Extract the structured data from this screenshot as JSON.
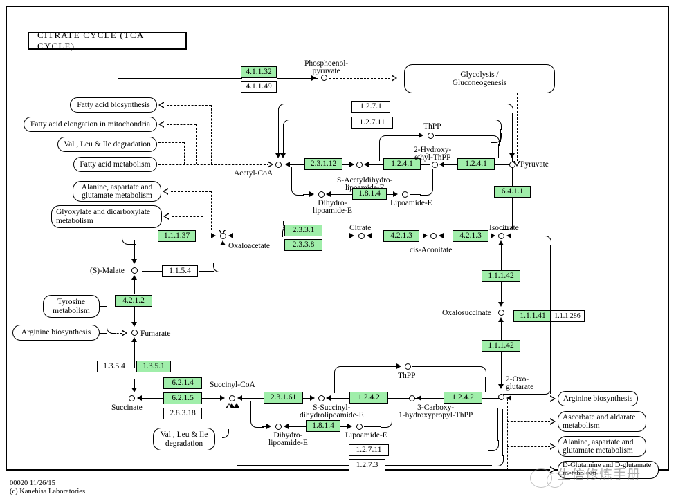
{
  "map": {
    "title": "CITRATE CYCLE (TCA CYCLE)",
    "footer": "00020 11/26/15\n(c) Kanehisa Laboratories",
    "watermark": "生信修炼手册",
    "accent_green": "#a0eeaa",
    "background": "#ffffff",
    "line_color": "#000000"
  },
  "compounds": {
    "phosphoenolpyruvate": "Phosphoenol-\npyruvate",
    "acetyl_coa": "Acetyl-CoA",
    "pyruvate": "Pyruvate",
    "thpp_top": "ThPP",
    "hydroxyethyl_thpp": "2-Hydroxy-\nethyl-ThPP",
    "s_acetyldihydrolipoamide_e": "S-Acetyldihydro-\nlipoamide-E",
    "dihydrolipoamide_e_top": "Dihydro-\nlipoamide-E",
    "lipoamide_e_top": "Lipoamide-E",
    "oxaloacetate": "Oxaloacetate",
    "citrate": "Citrate",
    "cis_aconitate": "cis-Aconitate",
    "isocitrate": "Isocitrate",
    "oxalosuccinate": "Oxalosuccinate",
    "oxoglutarate": "2-Oxo-\nglutarate",
    "s_malate": "(S)-Malate",
    "fumarate": "Fumarate",
    "succinate": "Succinate",
    "succinyl_coa": "Succinyl-CoA",
    "thpp_bottom": "ThPP",
    "s_succinyldihydrolipoamide_e": "S-Succinyl-\ndihydrolipoamide-E",
    "carboxy_hydroxypropyl_thpp": "3-Carboxy-\n1-hydroxypropyl-ThPP",
    "dihydrolipoamide_e_bottom": "Dihydro-\nlipoamide-E",
    "lipoamide_e_bottom": "Lipoamide-E"
  },
  "enzymes": {
    "ec_4_1_1_32": {
      "label": "4.1.1.32",
      "highlighted": true
    },
    "ec_4_1_1_49": {
      "label": "4.1.1.49",
      "highlighted": false
    },
    "ec_1_2_7_1": {
      "label": "1.2.7.1",
      "highlighted": false
    },
    "ec_1_2_7_11_top": {
      "label": "1.2.7.11",
      "highlighted": false
    },
    "ec_2_3_1_12": {
      "label": "2.3.1.12",
      "highlighted": true
    },
    "ec_1_2_4_1_a": {
      "label": "1.2.4.1",
      "highlighted": true
    },
    "ec_1_2_4_1_b": {
      "label": "1.2.4.1",
      "highlighted": true
    },
    "ec_1_8_1_4_top": {
      "label": "1.8.1.4",
      "highlighted": true
    },
    "ec_6_4_1_1": {
      "label": "6.4.1.1",
      "highlighted": true
    },
    "ec_1_1_1_37": {
      "label": "1.1.1.37",
      "highlighted": true
    },
    "ec_1_1_5_4": {
      "label": "1.1.5.4",
      "highlighted": false
    },
    "ec_2_3_3_1": {
      "label": "2.3.3.1",
      "highlighted": true
    },
    "ec_2_3_3_8": {
      "label": "2.3.3.8",
      "highlighted": true
    },
    "ec_4_2_1_3_a": {
      "label": "4.2.1.3",
      "highlighted": true
    },
    "ec_4_2_1_3_b": {
      "label": "4.2.1.3",
      "highlighted": true
    },
    "ec_1_1_1_42_top": {
      "label": "1.1.1.42",
      "highlighted": true
    },
    "ec_1_1_1_42_bottom": {
      "label": "1.1.1.42",
      "highlighted": true
    },
    "ec_1_1_1_41": {
      "label": "1.1.1.41",
      "highlighted": true
    },
    "ec_1_1_1_286": {
      "label": "1.1.1.286",
      "highlighted": false
    },
    "ec_4_2_1_2": {
      "label": "4.2.1.2",
      "highlighted": true
    },
    "ec_1_3_5_4": {
      "label": "1.3.5.4",
      "highlighted": false
    },
    "ec_1_3_5_1": {
      "label": "1.3.5.1",
      "highlighted": true
    },
    "ec_6_2_1_4": {
      "label": "6.2.1.4",
      "highlighted": true
    },
    "ec_6_2_1_5": {
      "label": "6.2.1.5",
      "highlighted": true
    },
    "ec_2_8_3_18": {
      "label": "2.8.3.18",
      "highlighted": false
    },
    "ec_2_3_1_61": {
      "label": "2.3.1.61",
      "highlighted": true
    },
    "ec_1_2_4_2_a": {
      "label": "1.2.4.2",
      "highlighted": true
    },
    "ec_1_2_4_2_b": {
      "label": "1.2.4.2",
      "highlighted": true
    },
    "ec_1_8_1_4_bottom": {
      "label": "1.8.1.4",
      "highlighted": true
    },
    "ec_1_2_7_11_bottom": {
      "label": "1.2.7.11",
      "highlighted": false
    },
    "ec_1_2_7_3": {
      "label": "1.2.7.3",
      "highlighted": false
    }
  },
  "pathways": {
    "glycolysis": "Glycolysis /\nGluconeogenesis",
    "fatty_acid_biosynthesis": "Fatty acid biosynthesis",
    "fatty_acid_elongation": "Fatty acid elongation in mitochondria",
    "val_leu_ile_degradation_top": "Val , Leu & Ile degradation",
    "fatty_acid_metabolism": "Fatty acid metabolism",
    "alanine_aspartate_glutamate_top": "Alanine, aspartate and\nglutamate metabolism",
    "glyoxylate_dicarboxylate": "Glyoxylate and dicarboxylate\nmetabolism",
    "tyrosine_metabolism": "Tyrosine\nmetabolism",
    "arginine_biosynthesis_left": "Arginine biosynthesis",
    "val_leu_ile_degradation_bottom": "Val , Leu & Ile\ndegradation",
    "arginine_biosynthesis_right": "Arginine biosynthesis",
    "ascorbate_aldarate": "Ascorbate and aldarate\nmetabolism",
    "alanine_aspartate_glutamate_right": "Alanine, aspartate and\nglutamate metabolism",
    "d_glutamine_d_glutamate": "D-Glutamine and D-glutamate metabolism"
  }
}
